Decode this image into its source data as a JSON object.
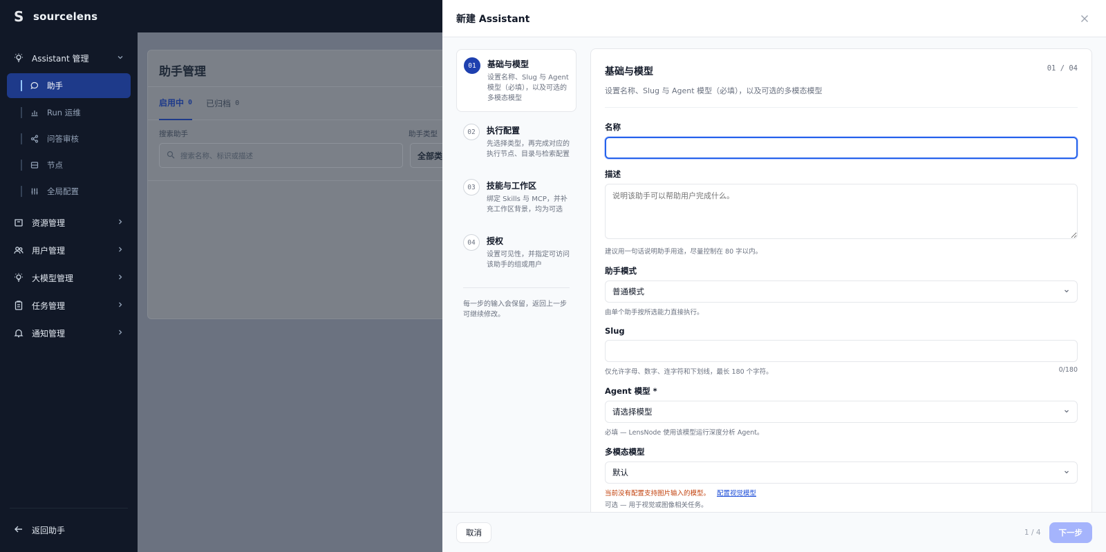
{
  "brand": {
    "name": "sourcelens",
    "logo_glyph": "S"
  },
  "sidebar": {
    "groups": [
      {
        "label": "Assistant 管理",
        "icon": "bulb-icon",
        "expanded": true
      },
      {
        "label": "资源管理",
        "icon": "archive-icon"
      },
      {
        "label": "用户管理",
        "icon": "users-icon"
      },
      {
        "label": "大模型管理",
        "icon": "bulb-icon"
      },
      {
        "label": "任务管理",
        "icon": "clipboard-icon"
      },
      {
        "label": "通知管理",
        "icon": "bell-icon"
      }
    ],
    "assistant_items": [
      {
        "label": "助手",
        "icon": "chat-icon",
        "active": true
      },
      {
        "label": "Run 运维",
        "icon": "bar-chart-icon"
      },
      {
        "label": "问答审核",
        "icon": "share-icon"
      },
      {
        "label": "节点",
        "icon": "server-icon"
      },
      {
        "label": "全局配置",
        "icon": "sliders-icon"
      }
    ],
    "back_label": "返回助手"
  },
  "background_page": {
    "title": "助手管理",
    "tabs": [
      {
        "label": "启用中",
        "count": "0",
        "active": true
      },
      {
        "label": "已归档",
        "count": "0"
      }
    ],
    "search_label": "搜索助手",
    "search_placeholder": "搜索名称、标识或描述",
    "type_label": "助手类型",
    "type_value": "全部类型"
  },
  "drawer": {
    "title": "新建 Assistant",
    "steps": [
      {
        "num": "01",
        "title": "基础与模型",
        "desc": "设置名称、Slug 与 Agent 模型（必填），以及可选的多模态模型",
        "active": true
      },
      {
        "num": "02",
        "title": "执行配置",
        "desc": "先选择类型，再完成对应的执行节点、目录与检索配置"
      },
      {
        "num": "03",
        "title": "技能与工作区",
        "desc": "绑定 Skills 与 MCP，并补充工作区背景，均为可选"
      },
      {
        "num": "04",
        "title": "授权",
        "desc": "设置可见性，并指定可访问该助手的组或用户"
      }
    ],
    "steps_note": "每一步的输入会保留，返回上一步可继续修改。",
    "form": {
      "title": "基础与模型",
      "subtitle": "设置名称、Slug 与 Agent 模型（必填），以及可选的多模态模型",
      "progress": "01 / 04",
      "name_label": "名称",
      "name_value": "",
      "desc_label": "描述",
      "desc_placeholder": "说明该助手可以帮助用户完成什么。",
      "desc_hint": "建议用一句话说明助手用途，尽量控制在 80 字以内。",
      "mode_label": "助手模式",
      "mode_value": "普通模式",
      "mode_hint": "由单个助手按所选能力直接执行。",
      "slug_label": "Slug",
      "slug_value": "",
      "slug_hint": "仅允许字母、数字、连字符和下划线，最长 180 个字符。",
      "slug_counter": "0/180",
      "agent_label": "Agent 模型 *",
      "agent_value": "请选择模型",
      "agent_hint": "必填 — LensNode 使用该模型运行深度分析 Agent。",
      "mm_label": "多模态模型",
      "mm_value": "默认",
      "mm_warn": "当前没有配置支持图片输入的模型。",
      "mm_link": "配置视觉模型",
      "mm_hint": "可选 — 用于视觉或图像相关任务。"
    },
    "footer": {
      "cancel": "取消",
      "page": "1 / 4",
      "next": "下一步"
    }
  },
  "colors": {
    "accent": "#1e40af",
    "sidebar_bg": "#111827",
    "warn": "#c2410c",
    "next_disabled": "#a5b4fc"
  }
}
